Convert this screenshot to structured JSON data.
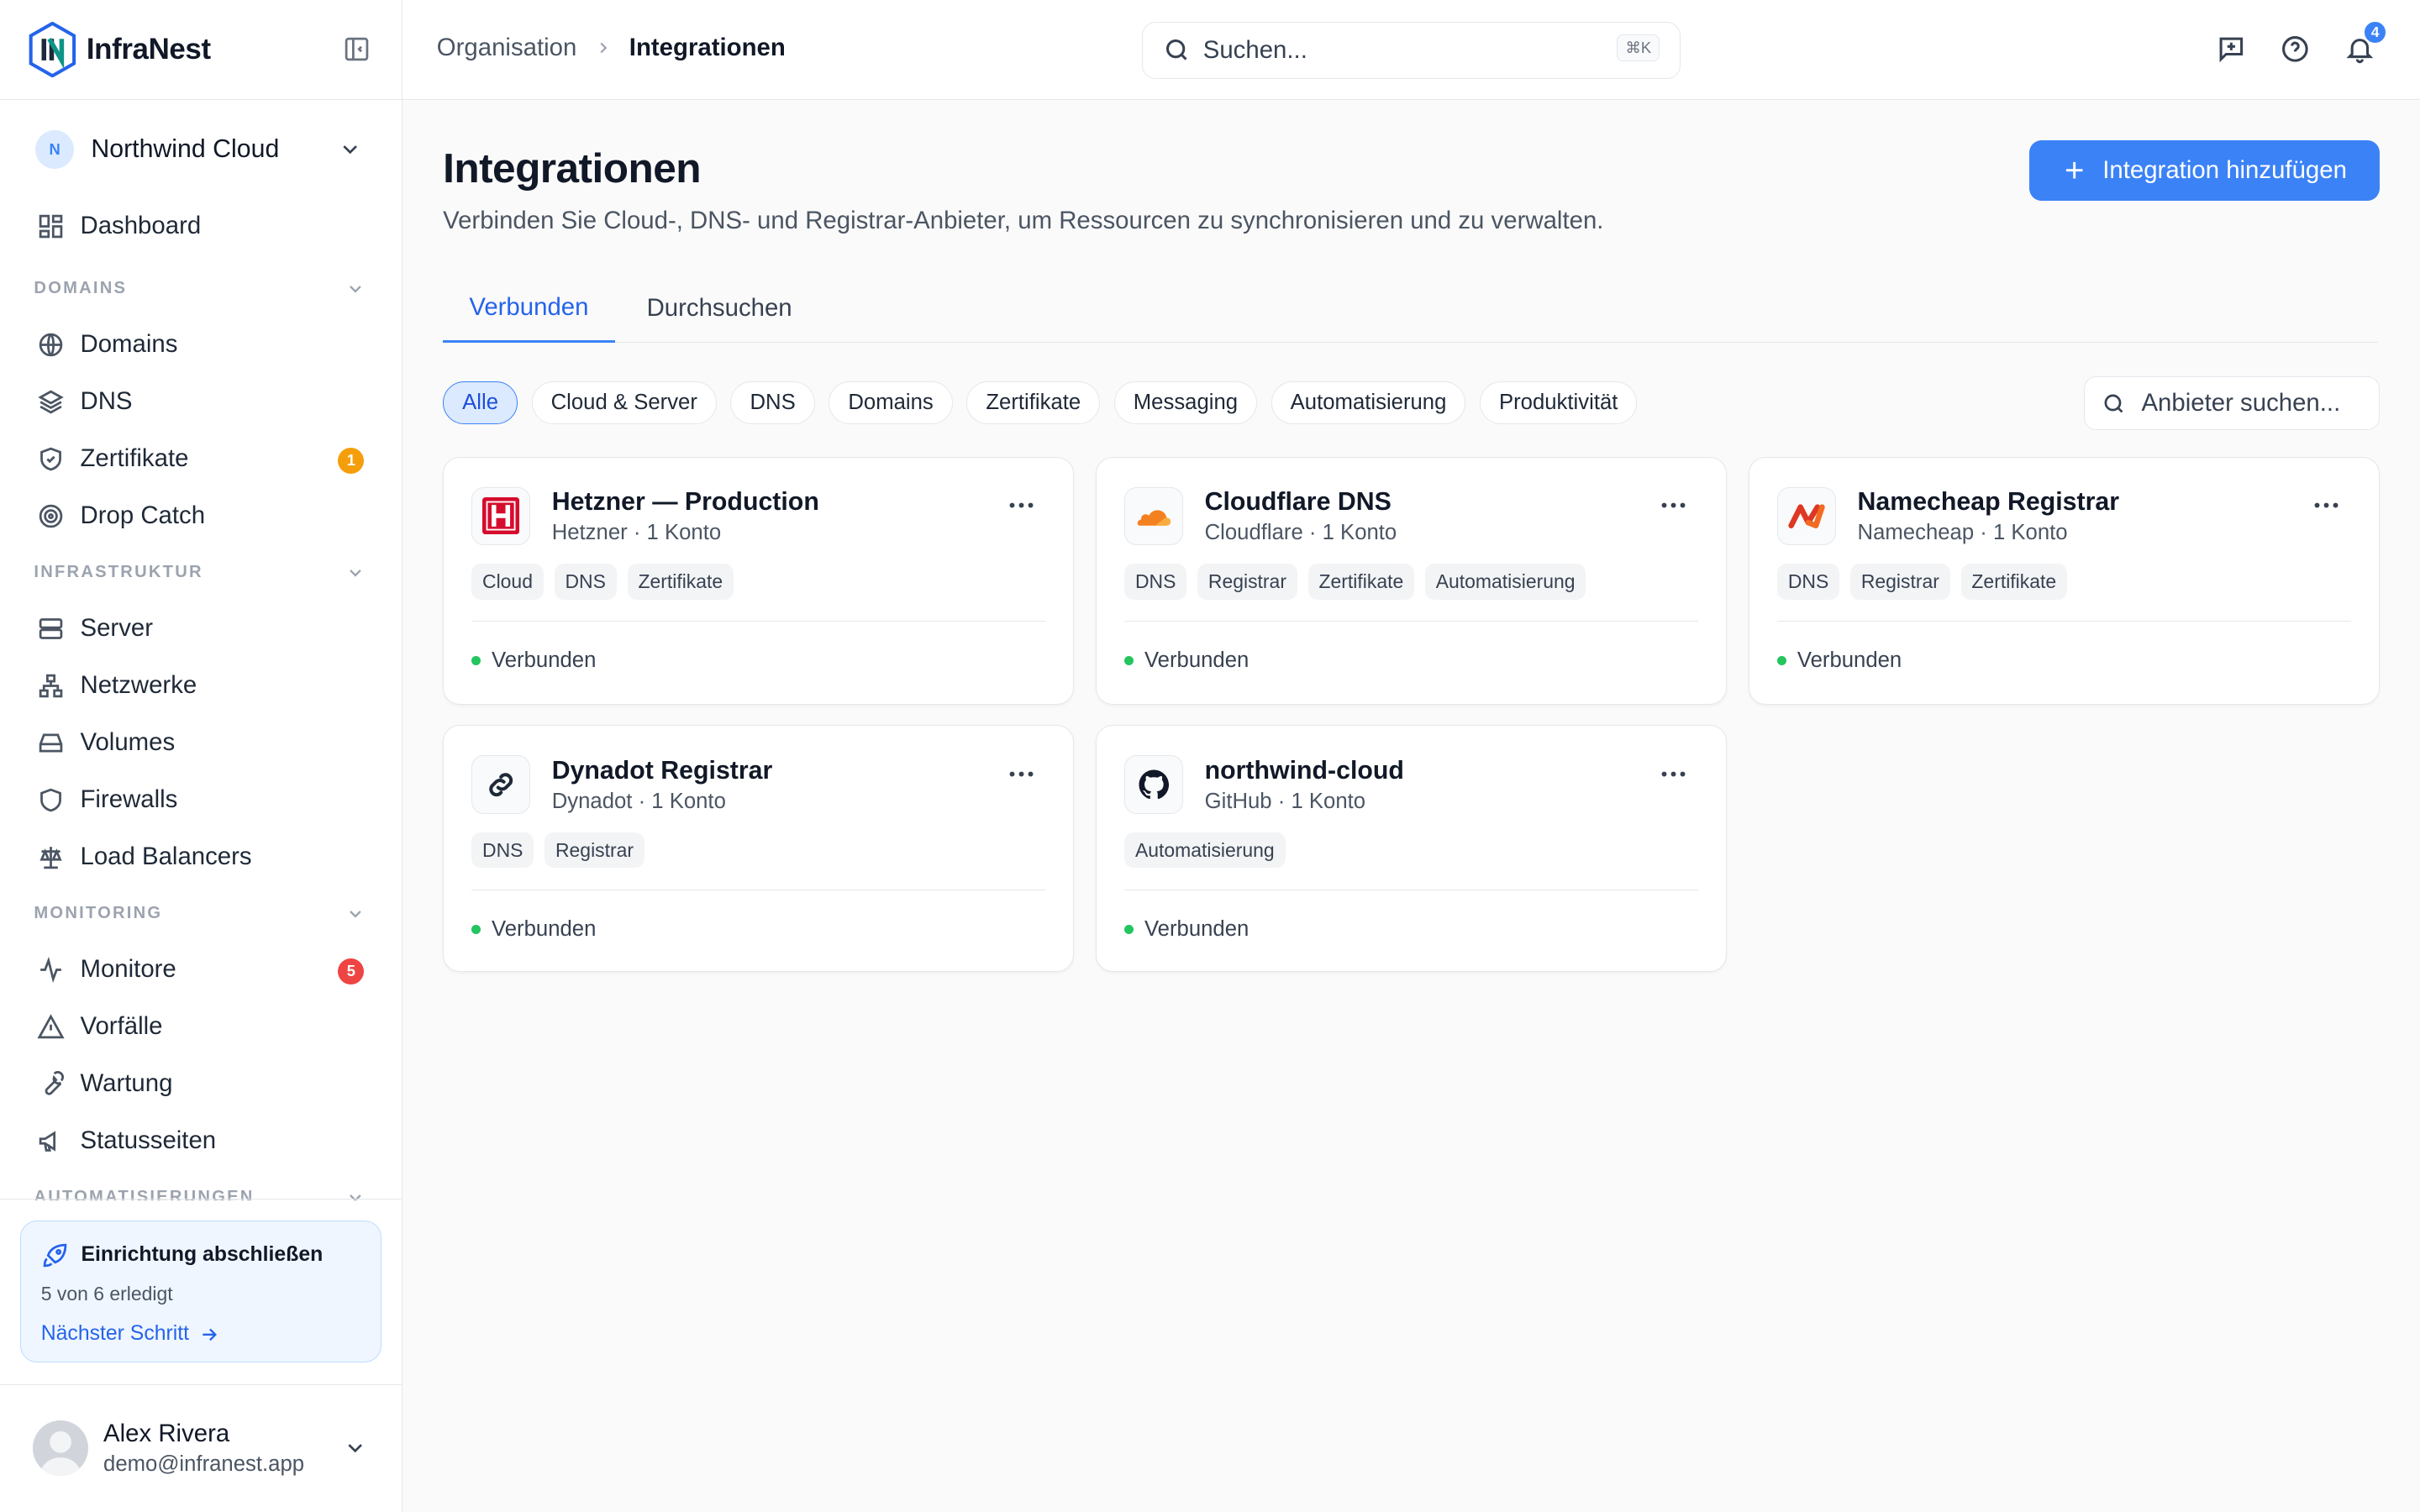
{
  "brand": {
    "name": "InfraNest"
  },
  "org": {
    "initial": "N",
    "name": "Northwind Cloud"
  },
  "nav": {
    "dashboard": "Dashboard",
    "sections": {
      "domains": "DOMAINS",
      "infrastructure": "INFRASTRUKTUR",
      "monitoring": "MONITORING",
      "automations": "AUTOMATISIERUNGEN"
    },
    "domains": "Domains",
    "dns": "DNS",
    "certificates": "Zertifikate",
    "certificates_badge": "1",
    "drop_catch": "Drop Catch",
    "server": "Server",
    "networks": "Netzwerke",
    "volumes": "Volumes",
    "firewalls": "Firewalls",
    "load_balancers": "Load Balancers",
    "monitors": "Monitore",
    "monitors_badge": "5",
    "incidents": "Vorfälle",
    "maintenance": "Wartung",
    "status_pages": "Statusseiten"
  },
  "setup": {
    "title": "Einrichtung abschließen",
    "progress": "5 von 6 erledigt",
    "next": "Nächster Schritt"
  },
  "user": {
    "name": "Alex Rivera",
    "email": "demo@infranest.app"
  },
  "breadcrumb": {
    "parent": "Organisation",
    "current": "Integrationen"
  },
  "search": {
    "placeholder": "Suchen...",
    "shortcut": "⌘K"
  },
  "notifications": {
    "count": "4"
  },
  "page": {
    "title": "Integrationen",
    "subtitle": "Verbinden Sie Cloud-, DNS- und Registrar-Anbieter, um Ressourcen zu synchronisieren und zu verwalten.",
    "add_button": "Integration hinzufügen"
  },
  "tabs": {
    "connected": "Verbunden",
    "browse": "Durchsuchen"
  },
  "filters": [
    "Alle",
    "Cloud & Server",
    "DNS",
    "Domains",
    "Zertifikate",
    "Messaging",
    "Automatisierung",
    "Produktivität"
  ],
  "provider_search": {
    "placeholder": "Anbieter suchen..."
  },
  "integrations": [
    {
      "title": "Hetzner — Production",
      "subtitle": "Hetzner · 1 Konto",
      "tags": [
        "Cloud",
        "DNS",
        "Zertifikate"
      ],
      "status": "Verbunden",
      "logo": "hetzner-logo"
    },
    {
      "title": "Cloudflare DNS",
      "subtitle": "Cloudflare · 1 Konto",
      "tags": [
        "DNS",
        "Registrar",
        "Zertifikate",
        "Automatisierung"
      ],
      "status": "Verbunden",
      "logo": "cloudflare-logo"
    },
    {
      "title": "Namecheap Registrar",
      "subtitle": "Namecheap · 1 Konto",
      "tags": [
        "DNS",
        "Registrar",
        "Zertifikate"
      ],
      "status": "Verbunden",
      "logo": "namecheap-logo"
    },
    {
      "title": "Dynadot Registrar",
      "subtitle": "Dynadot · 1 Konto",
      "tags": [
        "DNS",
        "Registrar"
      ],
      "status": "Verbunden",
      "logo": "dynadot-logo"
    },
    {
      "title": "northwind-cloud",
      "subtitle": "GitHub · 1 Konto",
      "tags": [
        "Automatisierung"
      ],
      "status": "Verbunden",
      "logo": "github-logo"
    }
  ],
  "colors": {
    "accent": "#3b82f6",
    "badge_warning": "#f59e0b",
    "badge_danger": "#ef4444",
    "status_ok": "#22c55e"
  }
}
